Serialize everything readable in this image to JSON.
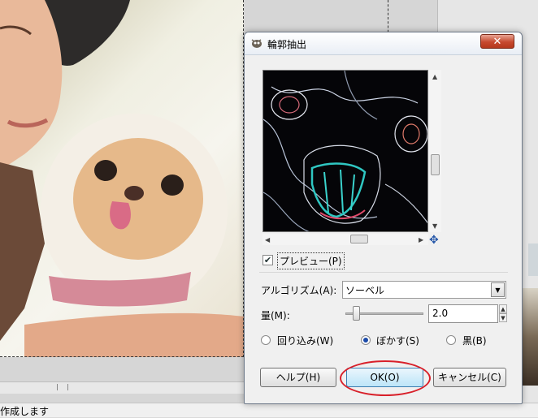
{
  "background": {
    "status_text": "作成します"
  },
  "dialog": {
    "title": "輪郭抽出",
    "close_label": "✕",
    "preview_label": "プレビュー(P)",
    "algorithm_label": "アルゴリズム(A):",
    "algorithm_value": "ソーベル",
    "amount_label": "量(M):",
    "amount_value": "2.0",
    "amount_slider_fraction": 0.1,
    "edge_options": [
      {
        "label": "回り込み(W)",
        "selected": false
      },
      {
        "label": "ぼかす(S)",
        "selected": true
      },
      {
        "label": "黒(B)",
        "selected": false
      }
    ],
    "buttons": {
      "help": "ヘルプ(H)",
      "ok": "OK(O)",
      "cancel": "キャンセル(C)"
    }
  },
  "colors": {
    "annotation_circle": "#d8202a",
    "close_button": "#c74a2e"
  }
}
